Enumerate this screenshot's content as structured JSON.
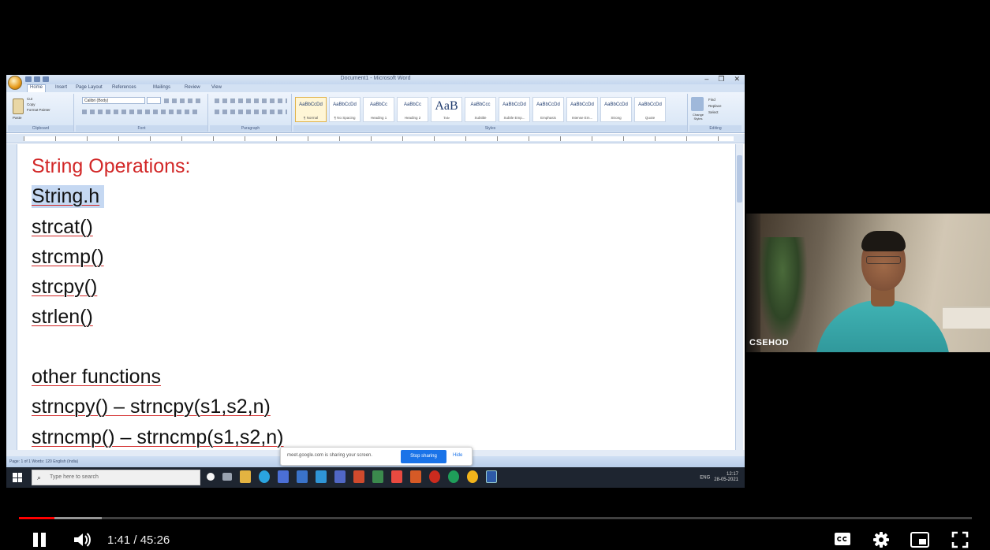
{
  "video": {
    "current_time": "1:41",
    "duration": "45:26",
    "progress": 0.037,
    "buffered": 0.087
  },
  "word": {
    "window_title": "Document1 - Microsoft Word",
    "tabs": [
      "Home",
      "Insert",
      "Page Layout",
      "References",
      "Mailings",
      "Review",
      "View"
    ],
    "ribbon": {
      "clipboard_label": "Clipboard",
      "font_label": "Font",
      "paragraph_label": "Paragraph",
      "styles_label": "Styles",
      "editing_label": "Editing",
      "font_name": "Calibri (Body)",
      "cut": "Cut",
      "copy": "Copy",
      "format_painter": "Format Painter",
      "paste": "Paste",
      "find": "Find",
      "replace": "Replace",
      "select": "Select",
      "change_styles": "Change Styles",
      "styles": [
        {
          "preview": "AaBbCcDd",
          "name": "¶ Normal"
        },
        {
          "preview": "AaBbCcDd",
          "name": "¶ No Spacing"
        },
        {
          "preview": "AaBbCc",
          "name": "Heading 1"
        },
        {
          "preview": "AaBbCc",
          "name": "Heading 2"
        },
        {
          "preview": "AaB",
          "name": "Title"
        },
        {
          "preview": "AaBbCcc",
          "name": "Subtitle"
        },
        {
          "preview": "AaBbCcDd",
          "name": "Subtle Emp..."
        },
        {
          "preview": "AaBbCcDd",
          "name": "Emphasis"
        },
        {
          "preview": "AaBbCcDd",
          "name": "Intense Em..."
        },
        {
          "preview": "AaBbCcDd",
          "name": "Strong"
        },
        {
          "preview": "AaBbCcDd",
          "name": "Quote"
        }
      ]
    },
    "document": {
      "heading": "String Operations:",
      "lines": [
        {
          "text": "String.h",
          "selected": true
        },
        {
          "text": "strcat()"
        },
        {
          "text": "strcmp()"
        },
        {
          "text": "strcpy()"
        },
        {
          "text": "strlen()"
        },
        {
          "text": ""
        },
        {
          "text": "other functions"
        },
        {
          "text": "strncpy() – strncpy(s1,s2,n)"
        },
        {
          "text": "strncmp() – strncmp(s1,s2,n)"
        }
      ]
    },
    "status": "Page: 1 of 1   Words: 120   English (India)"
  },
  "share_popup": {
    "message": "meet.google.com is sharing your screen.",
    "stop_label": "Stop sharing",
    "hide_label": "Hide"
  },
  "taskbar": {
    "search_placeholder": "Type here to search",
    "tray_lang": "ENG",
    "tray_time": "12:17",
    "tray_date": "28-05-2021"
  },
  "webcam": {
    "label": "CSEHOD"
  },
  "colors": {
    "heading_red": "#d22727",
    "progress_red": "#ff0000",
    "word_blue": "#d3e1f3",
    "selection": "#c5d8f2"
  }
}
